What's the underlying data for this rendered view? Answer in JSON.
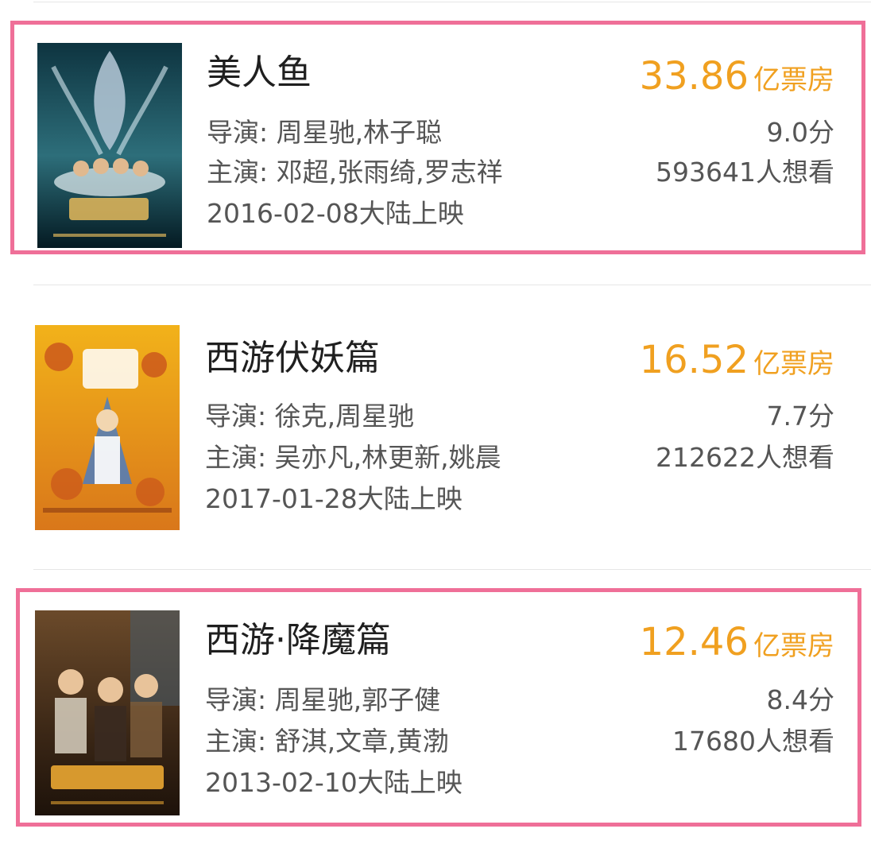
{
  "movies": [
    {
      "title": "美人鱼",
      "director": "导演: 周星驰,林子聪",
      "actors": "主演: 邓超,张雨绮,罗志祥",
      "release": "2016-02-08大陆上映",
      "box_office_value": "33.86",
      "box_office_unit": "亿票房",
      "score": "9.0分",
      "want": "593641人想看",
      "highlighted": true,
      "colors": {
        "poster_top": "#0e3440",
        "poster_bottom": "#041a22",
        "accent": "#d9b25a"
      }
    },
    {
      "title": "西游伏妖篇",
      "director": "导演: 徐克,周星驰",
      "actors": "主演: 吴亦凡,林更新,姚晨",
      "release": "2017-01-28大陆上映",
      "box_office_value": "16.52",
      "box_office_unit": "亿票房",
      "score": "7.7分",
      "want": "212622人想看",
      "highlighted": false,
      "colors": {
        "poster_top": "#f2b21a",
        "poster_bottom": "#d9771a",
        "accent": "#3a7bd5"
      }
    },
    {
      "title": "西游·降魔篇",
      "director": "导演: 周星驰,郭子健",
      "actors": "主演: 舒淇,文章,黄渤",
      "release": "2013-02-10大陆上映",
      "box_office_value": "12.46",
      "box_office_unit": "亿票房",
      "score": "8.4分",
      "want": "17680人想看",
      "highlighted": true,
      "colors": {
        "poster_top": "#6b4a2a",
        "poster_bottom": "#1d120a",
        "accent": "#e0a030"
      }
    }
  ],
  "colors": {
    "box_office": "#f0a020",
    "highlight_border": "#ef6f98",
    "divider": "#e6e6e6"
  }
}
